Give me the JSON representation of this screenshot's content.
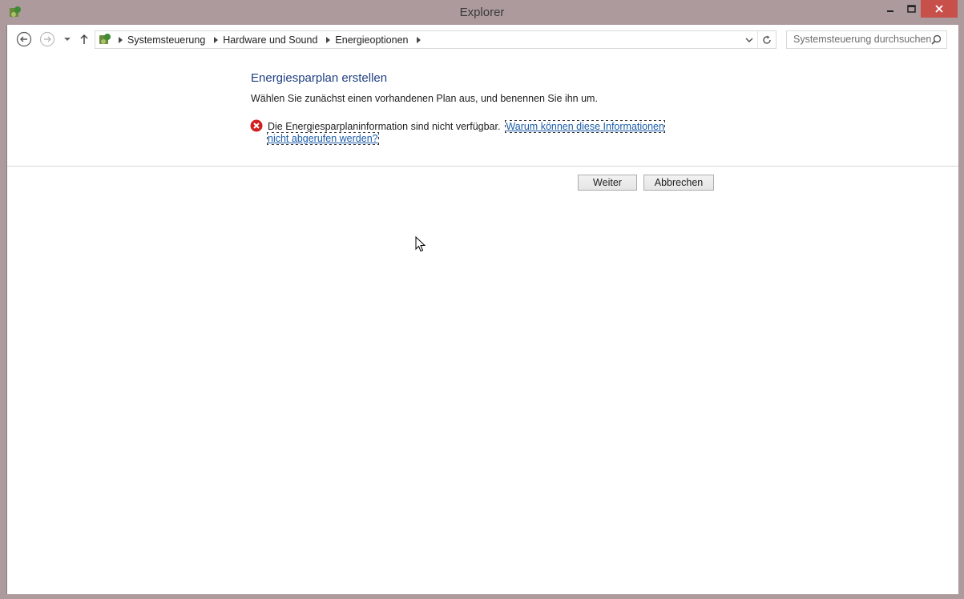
{
  "window": {
    "title": "Explorer",
    "icons": {
      "app": "control-panel-icon",
      "minimize": "minimize-icon",
      "maximize": "maximize-icon",
      "close": "close-icon"
    },
    "close_color": "#c7504b"
  },
  "navigation": {
    "back_icon": "back-arrow-icon",
    "forward_icon": "forward-arrow-icon",
    "recent_icon": "chevron-down-icon",
    "up_icon": "up-arrow-icon"
  },
  "address_bar": {
    "crumbs": [
      {
        "label": "Systemsteuerung"
      },
      {
        "label": "Hardware und Sound"
      },
      {
        "label": "Energieoptionen"
      }
    ],
    "dropdown_icon": "chevron-down-icon",
    "refresh_icon": "refresh-icon"
  },
  "search": {
    "placeholder": "Systemsteuerung durchsuchen",
    "icon": "search-icon"
  },
  "content": {
    "heading": "Energiesparplan erstellen",
    "subtext": "Wählen Sie zunächst einen vorhandenen Plan aus, und benennen Sie ihn um.",
    "error": {
      "icon": "error-icon",
      "message": "Die Energiesparplaninformation sind nicht verfügbar.",
      "link": "Warum können diese Informationen nicht abgerufen werden?"
    },
    "heading_color": "#1e3f82",
    "link_color": "#1a5ca8"
  },
  "buttons": {
    "next": "Weiter",
    "cancel": "Abbrechen"
  }
}
